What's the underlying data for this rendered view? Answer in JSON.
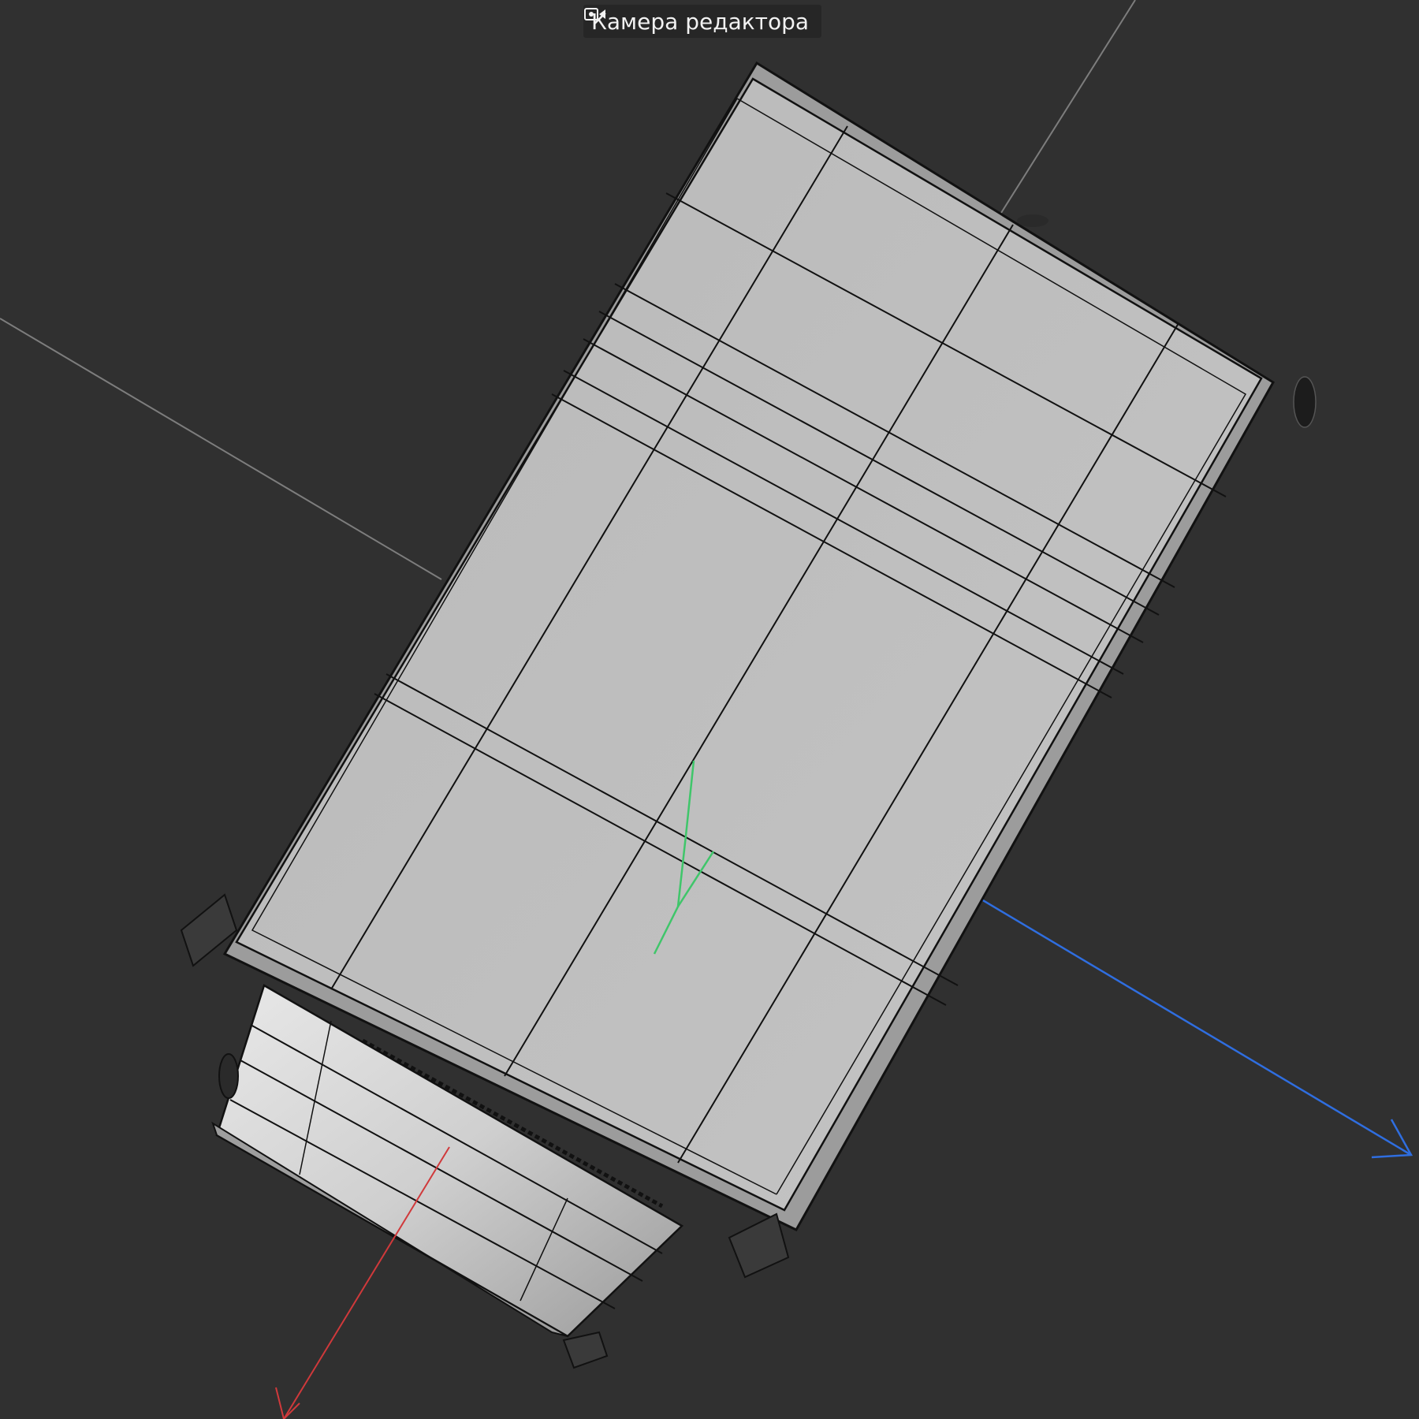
{
  "viewport": {
    "camera_label": "Камера редактора",
    "camera_icon": "camera-icon",
    "background_color": "#303030",
    "mesh_color": "#bdbdbd",
    "wire_color": "#111111",
    "axis_colors": {
      "x": "#d0393b",
      "y": "#3fc66a",
      "z": "#2f6ee0",
      "horizon": "#8a8a8a"
    }
  }
}
